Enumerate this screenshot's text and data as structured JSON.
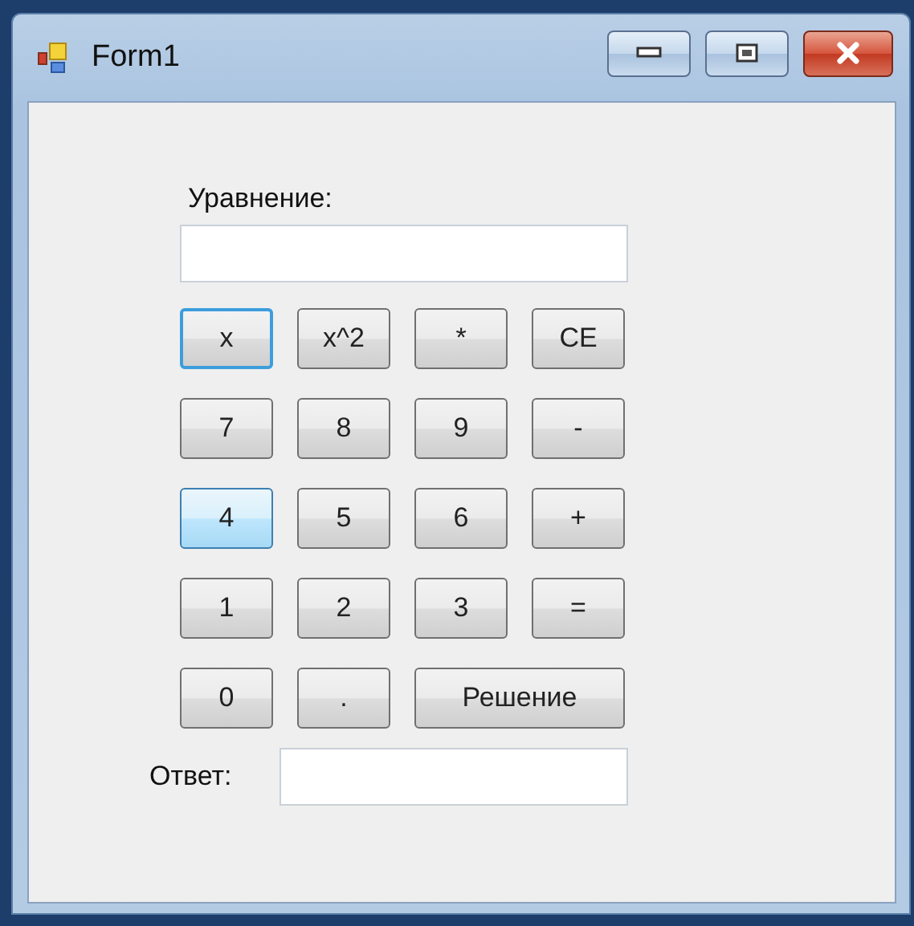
{
  "window": {
    "title": "Form1"
  },
  "equation": {
    "label": "Уравнение:"
  },
  "keypad": [
    [
      {
        "label": "x",
        "kind": "normal",
        "focused": true,
        "hovered": false
      },
      {
        "label": "x^2",
        "kind": "normal",
        "focused": false,
        "hovered": false
      },
      {
        "label": "*",
        "kind": "normal",
        "focused": false,
        "hovered": false
      },
      {
        "label": "CE",
        "kind": "normal",
        "focused": false,
        "hovered": false
      }
    ],
    [
      {
        "label": "7",
        "kind": "normal",
        "focused": false,
        "hovered": false
      },
      {
        "label": "8",
        "kind": "normal",
        "focused": false,
        "hovered": false
      },
      {
        "label": "9",
        "kind": "normal",
        "focused": false,
        "hovered": false
      },
      {
        "label": "-",
        "kind": "normal",
        "focused": false,
        "hovered": false
      }
    ],
    [
      {
        "label": "4",
        "kind": "normal",
        "focused": false,
        "hovered": true
      },
      {
        "label": "5",
        "kind": "normal",
        "focused": false,
        "hovered": false
      },
      {
        "label": "6",
        "kind": "normal",
        "focused": false,
        "hovered": false
      },
      {
        "label": "+",
        "kind": "normal",
        "focused": false,
        "hovered": false
      }
    ],
    [
      {
        "label": "1",
        "kind": "normal",
        "focused": false,
        "hovered": false
      },
      {
        "label": "2",
        "kind": "normal",
        "focused": false,
        "hovered": false
      },
      {
        "label": "3",
        "kind": "normal",
        "focused": false,
        "hovered": false
      },
      {
        "label": "=",
        "kind": "normal",
        "focused": false,
        "hovered": false
      }
    ],
    [
      {
        "label": "0",
        "kind": "normal",
        "focused": false,
        "hovered": false
      },
      {
        "label": ".",
        "kind": "normal",
        "focused": false,
        "hovered": false
      },
      {
        "label": "Решение",
        "kind": "wide",
        "focused": false,
        "hovered": false
      }
    ]
  ],
  "answer": {
    "label": "Ответ:"
  }
}
